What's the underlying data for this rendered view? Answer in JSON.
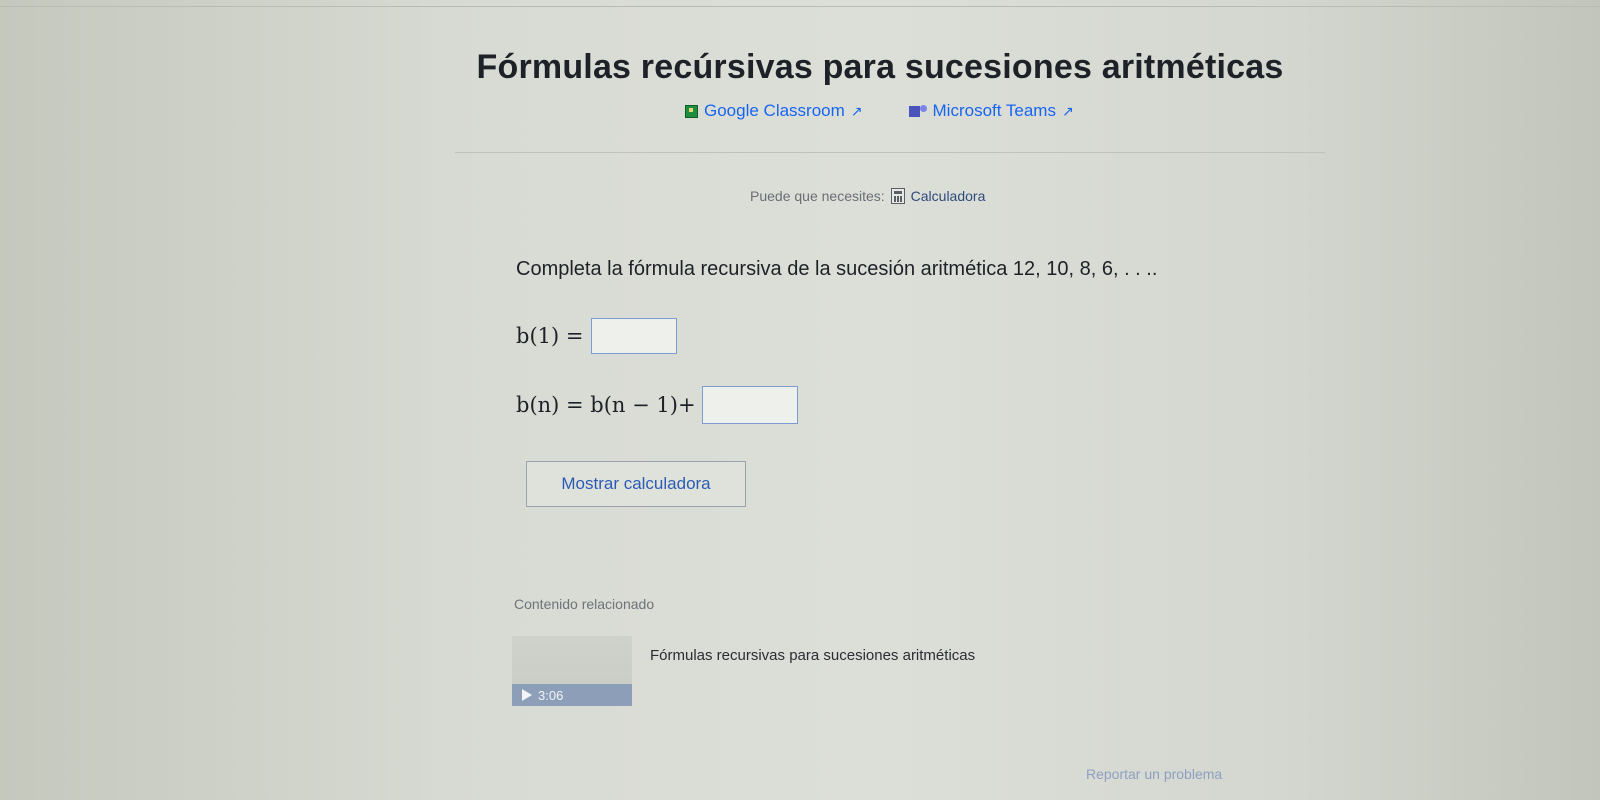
{
  "page": {
    "title": "Fórmulas recúrsivas para sucesiones aritméticas"
  },
  "share": {
    "google_classroom": {
      "label": "Google Classroom",
      "icon": "google-classroom-icon",
      "color": "#1e8e3e"
    },
    "microsoft_teams": {
      "label": "Microsoft Teams",
      "icon": "microsoft-teams-icon",
      "color": "#4b53bc"
    },
    "external_icon": "↗"
  },
  "tools": {
    "prefix": "Puede que necesites:",
    "calculator_label": "Calculadora",
    "calculator_icon": "calculator-icon"
  },
  "exercise": {
    "prompt": "Completa la fórmula recursiva de la sucesión aritmética 12, 10, 8, 6, . . ..",
    "line1_lhs": "b(1) =",
    "line1_value": "",
    "line2_lhs": "b(n) = b(n − 1)+",
    "line2_value": ""
  },
  "buttons": {
    "show_calculator": "Mostrar calculadora"
  },
  "related": {
    "heading": "Contenido relacionado",
    "video_title": "Fórmulas recursivas para sucesiones aritméticas",
    "video_duration": "3:06"
  },
  "footer": {
    "report_label": "Reportar un problema"
  },
  "colors": {
    "link": "#1865f2",
    "input_border": "#7d9cd3"
  }
}
